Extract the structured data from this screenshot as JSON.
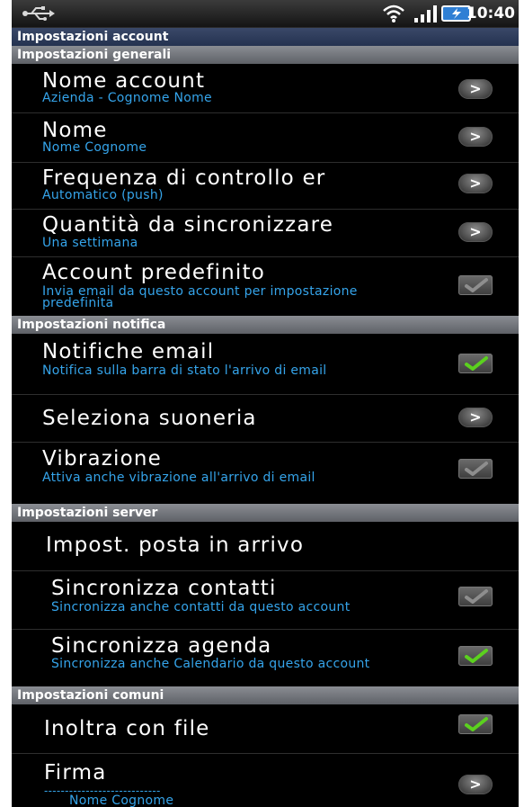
{
  "status_bar": {
    "time": "10:40",
    "icons": [
      "usb-icon",
      "wifi-icon",
      "signal-icon",
      "battery-icon"
    ]
  },
  "title": "Impostazioni account",
  "sections": {
    "generali": "Impostazioni generali",
    "notifica": "Impostazioni notifica",
    "server": "Impostazioni server",
    "comuni": "Impostazioni comuni"
  },
  "items": {
    "nome_account": {
      "title": "Nome account",
      "subtitle": "Azienda - Cognome Nome"
    },
    "nome": {
      "title": "Nome",
      "subtitle": "Nome Cognome"
    },
    "frequenza": {
      "title": "Frequenza di controllo er",
      "subtitle": "Automatico (push)"
    },
    "quantita": {
      "title": "Quantità da sincronizzare",
      "subtitle": "Una settimana"
    },
    "account_predefinito": {
      "title": "Account predefinito",
      "subtitle": "Invia email da questo account per impostazione predefinita",
      "checked": false
    },
    "notifiche_email": {
      "title": "Notifiche email",
      "subtitle": "Notifica sulla barra di stato l'arrivo di email",
      "checked": true
    },
    "suoneria": {
      "title": "Seleziona suoneria"
    },
    "vibrazione": {
      "title": "Vibrazione",
      "subtitle": "Attiva anche vibrazione all'arrivo di email",
      "checked": false
    },
    "posta_arrivo": {
      "title": "Impost. posta in arrivo"
    },
    "sinc_contatti": {
      "title": "Sincronizza contatti",
      "subtitle": "Sincronizza anche contatti da questo account",
      "checked": false
    },
    "sinc_agenda": {
      "title": "Sincronizza agenda",
      "subtitle": "Sincronizza anche Calendario da questo account",
      "checked": true
    },
    "inoltra": {
      "title": "Inoltra con file",
      "checked": true
    },
    "firma": {
      "title": "Firma",
      "subtitle": "Nome Cognome",
      "separator": "----------------------------"
    }
  },
  "glyphs": {
    "arrow": ">"
  },
  "colors": {
    "subtitle": "#35a4ea",
    "check_on": "#5bd11e",
    "check_off": "#8e8e8e"
  }
}
